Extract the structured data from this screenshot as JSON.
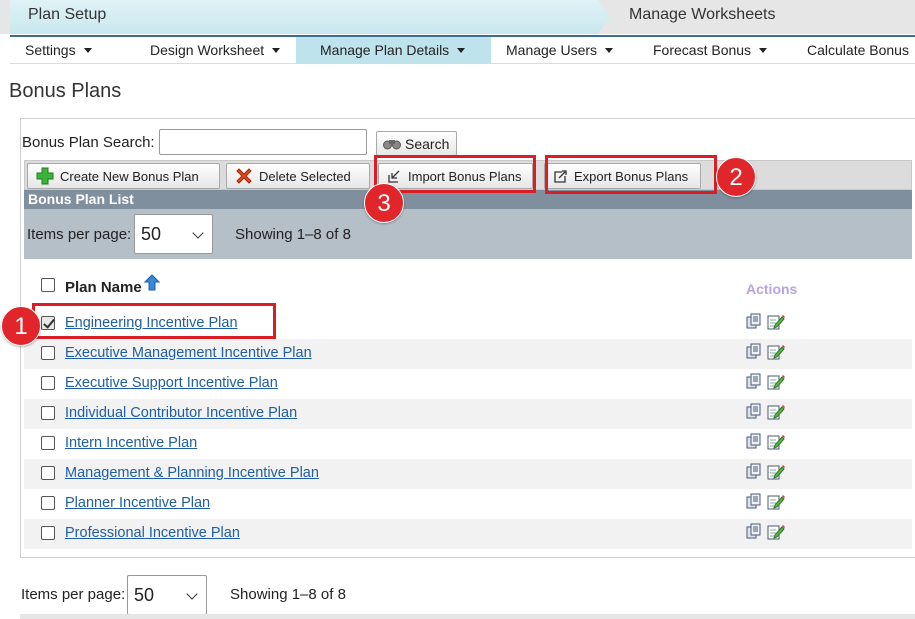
{
  "steps": {
    "step1": "Plan Setup",
    "step2": "Manage Worksheets"
  },
  "nav": {
    "items": [
      {
        "label": "Settings"
      },
      {
        "label": "Design Worksheet"
      },
      {
        "label": "Manage Plan Details"
      },
      {
        "label": "Manage Users"
      },
      {
        "label": "Forecast Bonus"
      },
      {
        "label": "Calculate Bonus"
      }
    ],
    "active": "Manage Plan Details"
  },
  "page": {
    "title": "Bonus Plans"
  },
  "search": {
    "label": "Bonus Plan Search:",
    "value": "",
    "button": "Search"
  },
  "toolbar": {
    "create": "Create New Bonus Plan",
    "delete": "Delete Selected",
    "import": "Import Bonus Plans",
    "export": "Export Bonus Plans"
  },
  "list": {
    "header": "Bonus Plan List",
    "items_per_page_label": "Items per page:",
    "items_per_page": "50",
    "showing": "Showing 1–8 of 8",
    "col_plan_name": "Plan Name",
    "col_actions": "Actions",
    "rows": [
      {
        "name": "Engineering Incentive Plan",
        "checked": true
      },
      {
        "name": "Executive Management Incentive Plan",
        "checked": false
      },
      {
        "name": "Executive Support Incentive Plan",
        "checked": false
      },
      {
        "name": "Individual Contributor Incentive Plan",
        "checked": false
      },
      {
        "name": "Intern Incentive Plan",
        "checked": false
      },
      {
        "name": "Management & Planning Incentive Plan",
        "checked": false
      },
      {
        "name": "Planner Incentive Plan",
        "checked": false
      },
      {
        "name": "Professional Incentive Plan",
        "checked": false
      }
    ]
  },
  "callouts": {
    "one": "1",
    "two": "2",
    "three": "3"
  },
  "colors": {
    "highlight": "#d91e25",
    "link": "#1f5fa1",
    "nav_active": "#bfe3ec"
  }
}
